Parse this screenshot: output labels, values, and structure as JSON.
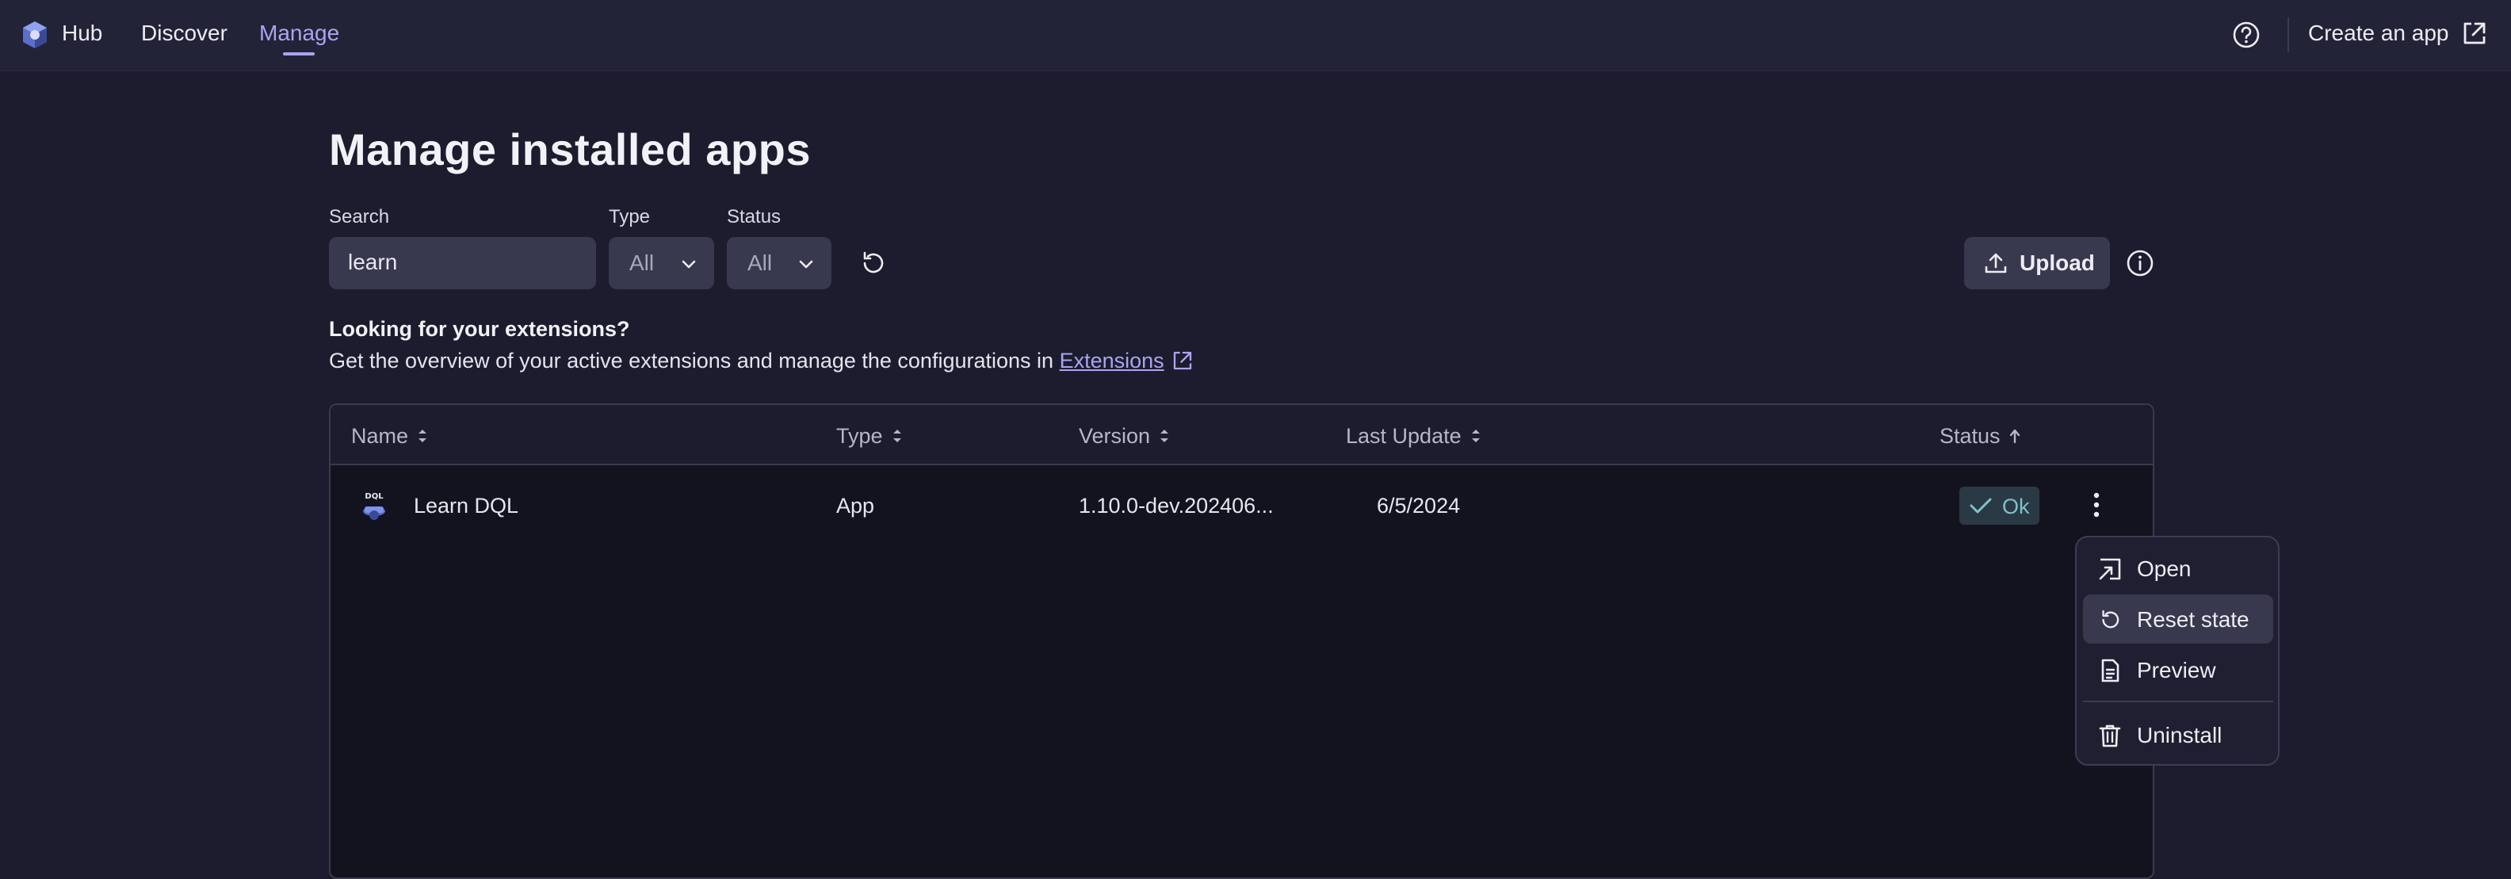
{
  "nav": {
    "hub_label": "Hub",
    "discover_label": "Discover",
    "manage_label": "Manage",
    "create_label": "Create an app",
    "icons": [
      "hub-logo-icon",
      "help-icon",
      "external-link-icon"
    ]
  },
  "page": {
    "title": "Manage installed apps"
  },
  "filters": {
    "search_label": "Search",
    "search_value": "learn",
    "type_label": "Type",
    "type_value": "All",
    "status_label": "Status",
    "status_value": "All"
  },
  "upload_label": "Upload",
  "extensions": {
    "heading": "Looking for your extensions?",
    "text": "Get the overview of your active extensions and manage the configurations in",
    "link": "Extensions"
  },
  "table": {
    "columns": [
      "Name",
      "Type",
      "Version",
      "Last Update",
      "Status"
    ],
    "rows": [
      {
        "icon_text": "DQL",
        "name": "Learn DQL",
        "type": "App",
        "version": "1.10.0-dev.202406...",
        "last_update": "6/5/2024",
        "status": "Ok"
      }
    ]
  },
  "menu": {
    "items": [
      "Open",
      "Reset state",
      "Preview",
      "Uninstall"
    ],
    "active_item": "Reset state"
  },
  "colors": {
    "accent": "#a9a5f0",
    "background": "#1c1c2e",
    "status_ok": "#7fc0cc"
  }
}
